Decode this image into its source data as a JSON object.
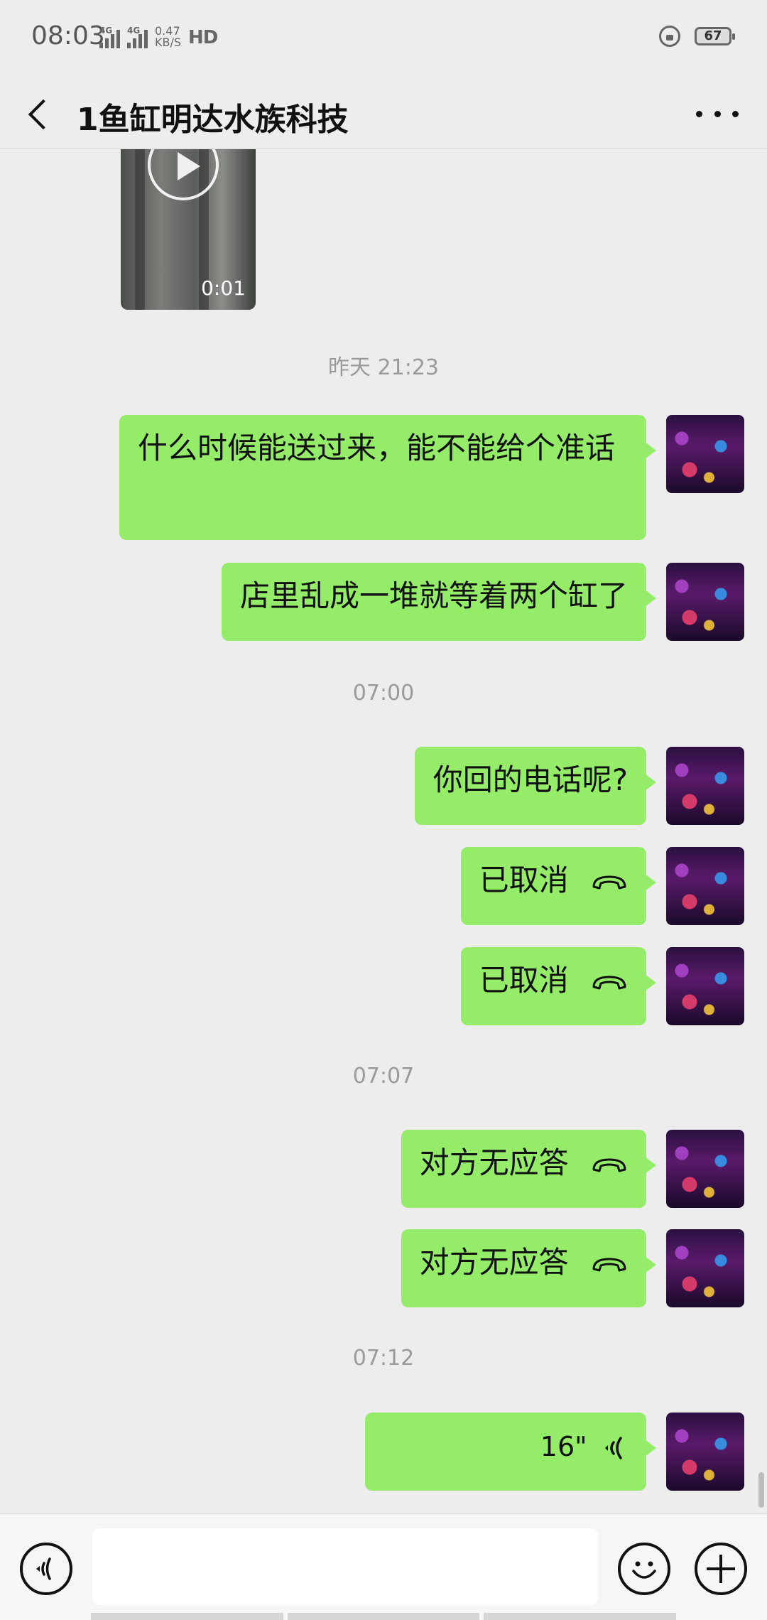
{
  "status_bar": {
    "time": "08:03",
    "network": [
      "4G",
      "4G"
    ],
    "speed_value": "0.47",
    "speed_unit": "KB/S",
    "hd": "HD",
    "battery": "67"
  },
  "header": {
    "title": "1鱼缸明达水族科技"
  },
  "video": {
    "duration": "0:01"
  },
  "messages": [
    {
      "type": "timestamp",
      "text": "昨天 21:23"
    },
    {
      "type": "text",
      "text": "什么时候能送过来，能不能给个准话"
    },
    {
      "type": "text",
      "text": "店里乱成一堆就等着两个缸了"
    },
    {
      "type": "timestamp",
      "text": "07:00"
    },
    {
      "type": "text",
      "text": "你回的电话呢?"
    },
    {
      "type": "call",
      "text": "已取消",
      "icon": "phone-hangup-icon"
    },
    {
      "type": "call",
      "text": "已取消",
      "icon": "phone-hangup-icon"
    },
    {
      "type": "timestamp",
      "text": "07:07"
    },
    {
      "type": "call",
      "text": "对方无应答",
      "icon": "phone-hangup-icon"
    },
    {
      "type": "call",
      "text": "对方无应答",
      "icon": "phone-hangup-icon"
    },
    {
      "type": "timestamp",
      "text": "07:12"
    },
    {
      "type": "voice",
      "text": "16\"",
      "icon": "voice-wave-icon"
    }
  ],
  "input_bar": {
    "voice_icon": "voice-mode-icon",
    "emoji_icon": "emoji-icon",
    "add_icon": "add-icon"
  },
  "colors": {
    "bubble": "#95ec69",
    "background": "#ededed"
  }
}
